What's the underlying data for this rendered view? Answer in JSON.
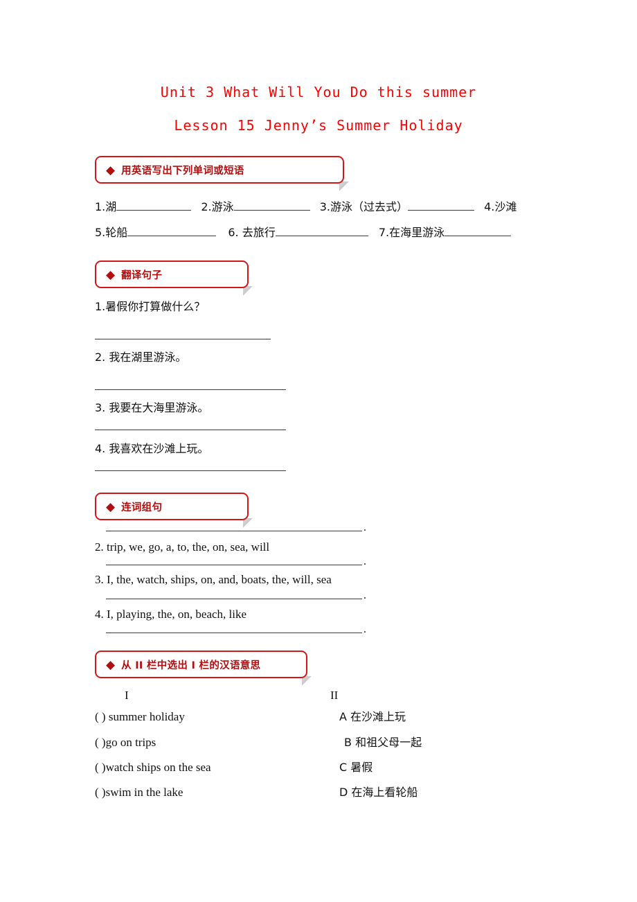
{
  "document": {
    "title": "Unit 3 What Will You Do this summer",
    "subtitle": "Lesson 15 Jenny’s Summer Holiday",
    "title_color": "#ff0000",
    "header_color": "#b50d0d",
    "bullet_icon": "◆"
  },
  "sections": [
    {
      "id": "write-in-english",
      "heading": "用英语写出下列单词或短语",
      "rows": [
        [
          {
            "label": "1.湖",
            "blank": true
          },
          {
            "label": "2.游泳",
            "blank": true
          },
          {
            "label": "3.游泳（过去式）",
            "blank": true
          },
          {
            "label": "4.沙滩",
            "blank": false
          }
        ],
        [
          {
            "label": "5.轮船",
            "blank": true
          },
          {
            "label": "6. 去旅行",
            "blank": true
          },
          {
            "label": "7.在海里游泳",
            "blank": true
          }
        ]
      ]
    },
    {
      "id": "translate-sentences",
      "heading": "翻译句子",
      "items": [
        "1.暑假你打算做什么？",
        "2. 我在湖里游泳。",
        "3. 我要在大海里游泳。",
        "4. 我喜欢在沙滩上玩。"
      ]
    },
    {
      "id": "word-order",
      "heading": "连词组句",
      "items": [
        "2. trip, we, go, a, to, the, on, sea, will",
        "3. I, the, watch, ships, on, and, boats, the, will, sea",
        "4. I, playing, the, on, beach, like"
      ],
      "answer_end_mark": "."
    },
    {
      "id": "matching",
      "heading": "从 II 栏中选出 I 栏的汉语意思",
      "column_headings": {
        "left": "I",
        "right": "II"
      },
      "left_items": [
        "(    ) summer holiday",
        "(    )go on trips",
        "(    )watch ships on the sea",
        "(    )swim in the lake"
      ],
      "right_items": [
        "A  在沙滩上玩",
        "B  和祖父母一起",
        "C  暑假",
        "D  在海上看轮船"
      ]
    }
  ]
}
